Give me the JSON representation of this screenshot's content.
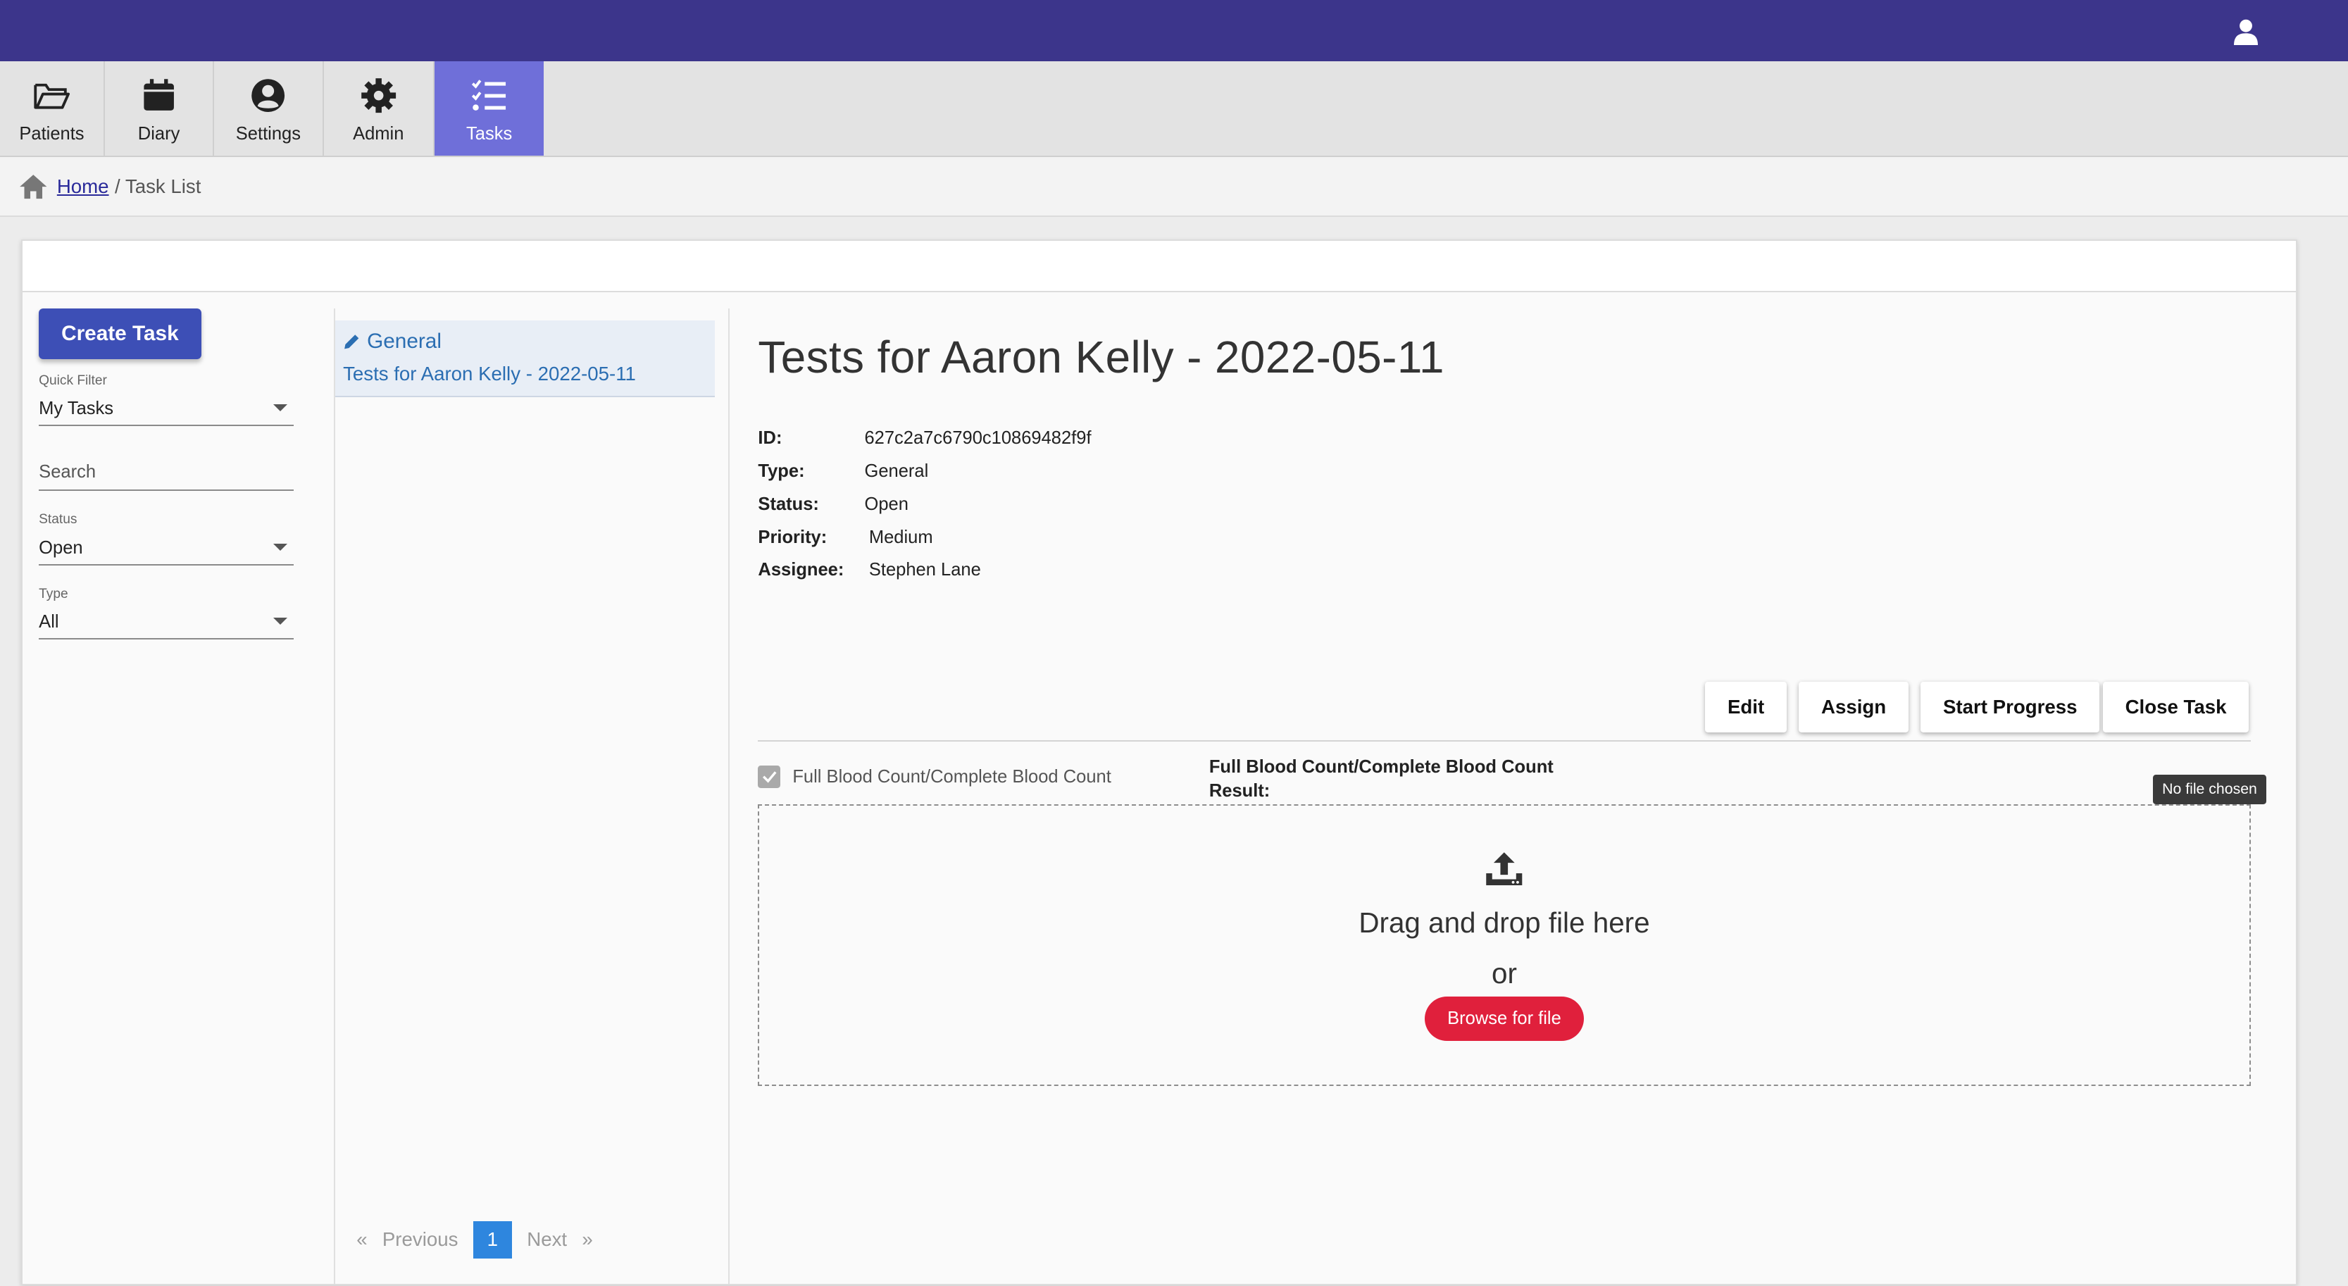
{
  "nav": {
    "items": [
      {
        "label": "Patients",
        "icon": "folder-open-icon"
      },
      {
        "label": "Diary",
        "icon": "calendar-icon"
      },
      {
        "label": "Settings",
        "icon": "user-circle-icon"
      },
      {
        "label": "Admin",
        "icon": "gear-icon"
      },
      {
        "label": "Tasks",
        "icon": "task-list-icon",
        "active": true
      }
    ]
  },
  "breadcrumb": {
    "home": "Home",
    "current": "/ Task List"
  },
  "filters": {
    "create_button": "Create Task",
    "quick_filter": {
      "label": "Quick Filter",
      "value": "My Tasks"
    },
    "search_placeholder": "Search",
    "status": {
      "label": "Status",
      "value": "Open"
    },
    "type": {
      "label": "Type",
      "value": "All"
    }
  },
  "task_list": {
    "items": [
      {
        "type": "General",
        "title": "Tests for Aaron Kelly - 2022-05-11"
      }
    ]
  },
  "pagination": {
    "prev": "Previous",
    "page": "1",
    "next": "Next",
    "prev_arrow": "«",
    "next_arrow": "»"
  },
  "task": {
    "title": "Tests for Aaron Kelly - 2022-05-11",
    "props": [
      {
        "key": "ID:",
        "value": "627c2a7c6790c10869482f9f"
      },
      {
        "key": "Type:",
        "value": "General"
      },
      {
        "key": "Status:",
        "value": "Open"
      },
      {
        "key": "Priority:",
        "value": "Medium"
      },
      {
        "key": "Assignee:",
        "value": "Stephen Lane"
      }
    ],
    "actions": {
      "edit": "Edit",
      "assign": "Assign",
      "start": "Start Progress",
      "close": "Close Task"
    },
    "test_item": {
      "label": "Full Blood Count/Complete Blood Count",
      "checked": true
    },
    "result_label_1": "Full Blood Count/Complete Blood Count",
    "result_label_2": "Result:",
    "dropzone": {
      "text": "Drag and drop file here",
      "or": "or",
      "browse": "Browse for file"
    },
    "tooltip": "No file chosen"
  },
  "colors": {
    "topbar": "#3c358b",
    "active_tab": "#6f6fd9",
    "primary_button": "#3d4fb6",
    "browse_button": "#e0203c",
    "link": "#2b6eb2"
  }
}
